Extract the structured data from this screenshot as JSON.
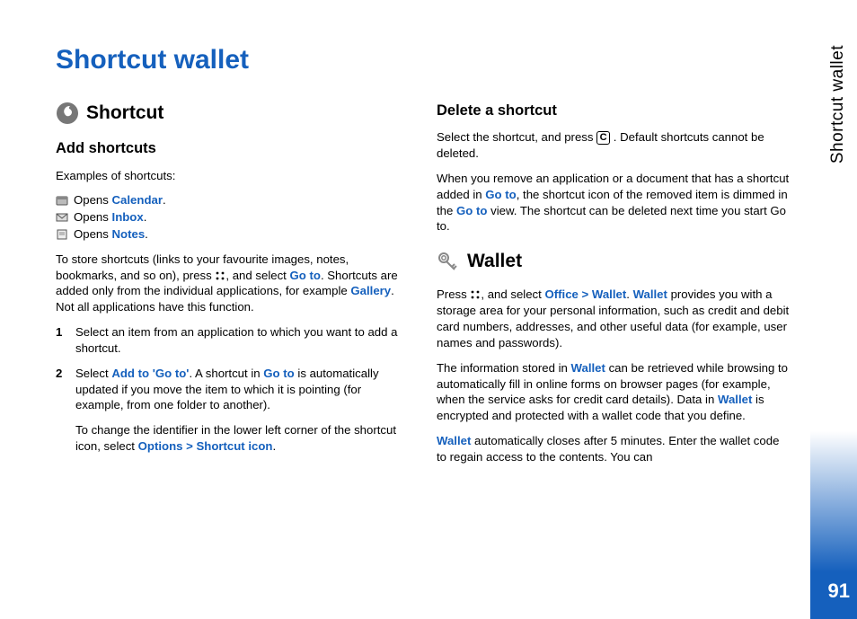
{
  "side_tab": "Shortcut wallet",
  "page_number": "91",
  "title": "Shortcut wallet",
  "left": {
    "section_heading": "Shortcut",
    "sub_heading": "Add shortcuts",
    "intro": "Examples of shortcuts:",
    "items": [
      {
        "prefix": "Opens ",
        "link": "Calendar",
        "suffix": "."
      },
      {
        "prefix": "Opens ",
        "link": "Inbox",
        "suffix": "."
      },
      {
        "prefix": "Opens ",
        "link": "Notes",
        "suffix": "."
      }
    ],
    "para1_a": "To store shortcuts (links to your favourite images, notes, bookmarks, and so on), press ",
    "para1_b": ", and select ",
    "para1_link1": "Go to",
    "para1_c": ". Shortcuts are added only from the individual applications, for example ",
    "para1_link2": "Gallery",
    "para1_d": ". Not all applications have this function.",
    "step1": "Select an item from an application to which you want to add a shortcut.",
    "step2_a": "Select ",
    "step2_link1": "Add to 'Go to'",
    "step2_b": ". A shortcut in ",
    "step2_link2": "Go to",
    "step2_c": " is automatically updated if you move the item to which it is pointing (for example, from one folder to another).",
    "step2_sub_a": "To change the identifier in the lower left corner of the shortcut icon, select ",
    "step2_sub_link": "Options > Shortcut icon",
    "step2_sub_b": "."
  },
  "right": {
    "del_heading": "Delete a shortcut",
    "del_p1_a": "Select the shortcut, and press ",
    "del_key": "C",
    "del_p1_b": " . Default shortcuts cannot be deleted.",
    "del_p2_a": "When you remove an application or a document that has a shortcut added in ",
    "del_p2_link1": "Go to",
    "del_p2_b": ", the shortcut icon of the removed item is dimmed in the ",
    "del_p2_link2": "Go to",
    "del_p2_c": " view. The shortcut can be deleted next time you start Go to.",
    "wallet_heading": "Wallet",
    "w_p1_a": "Press ",
    "w_p1_b": ", and select ",
    "w_p1_link1": "Office > Wallet",
    "w_p1_c": ". ",
    "w_p1_link2": "Wallet",
    "w_p1_d": " provides you with a storage area for your personal information, such as credit and debit card numbers, addresses, and other useful data (for example, user names and passwords).",
    "w_p2_a": "The information stored in ",
    "w_p2_link1": "Wallet",
    "w_p2_b": " can be retrieved while browsing to automatically fill in online forms on browser pages (for example, when the service asks for credit card details). Data in ",
    "w_p2_link2": "Wallet",
    "w_p2_c": " is encrypted and protected with a wallet code that you define.",
    "w_p3_link": "Wallet",
    "w_p3_a": " automatically closes after 5 minutes. Enter the wallet code to regain access to the contents. You can"
  }
}
